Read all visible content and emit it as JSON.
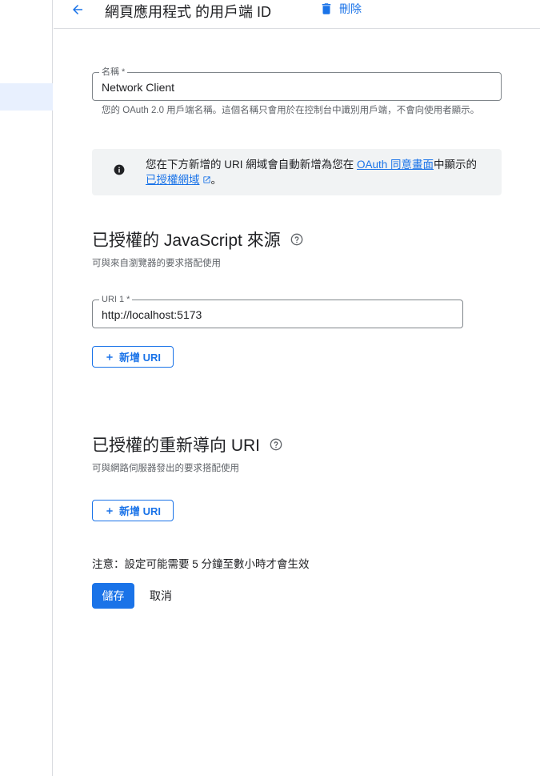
{
  "header": {
    "back_icon": "arrow-left-icon",
    "title": "網頁應用程式 的用戶端 ID",
    "delete_icon": "trash-icon",
    "delete_label": "刪除"
  },
  "name_field": {
    "label": "名稱 *",
    "value": "Network Client",
    "hint": "您的 OAuth 2.0 用戶端名稱。這個名稱只會用於在控制台中識別用戶端，不會向使用者顯示。"
  },
  "info_banner": {
    "icon": "info-icon",
    "text_before": "您在下方新增的 URI 網域會自動新增為您在 ",
    "link1": "OAuth 同意畫面",
    "text_middle": "中顯示的",
    "link2": "已授權網域",
    "link2_icon": "external-link-icon",
    "text_after": "。"
  },
  "js_origins": {
    "title": "已授權的 JavaScript 來源",
    "help_icon": "help-circle-icon",
    "subtitle": "可與來自瀏覽器的要求搭配使用",
    "uri_label": "URI 1 *",
    "uri_value": "http://localhost:5173",
    "add_label": "新增 URI",
    "add_icon": "plus-icon"
  },
  "redirect_uris": {
    "title": "已授權的重新導向 URI",
    "help_icon": "help-circle-icon",
    "subtitle": "可與網路伺服器發出的要求搭配使用",
    "add_label": "新增 URI",
    "add_icon": "plus-icon"
  },
  "footer": {
    "note": "注意：設定可能需要 5 分鐘至數小時才會生效",
    "save_label": "儲存",
    "cancel_label": "取消"
  },
  "colors": {
    "accent": "#1a73e8",
    "border": "#dadce0",
    "banner_bg": "#f1f3f4",
    "nav_active_bg": "#e8f0fe"
  }
}
